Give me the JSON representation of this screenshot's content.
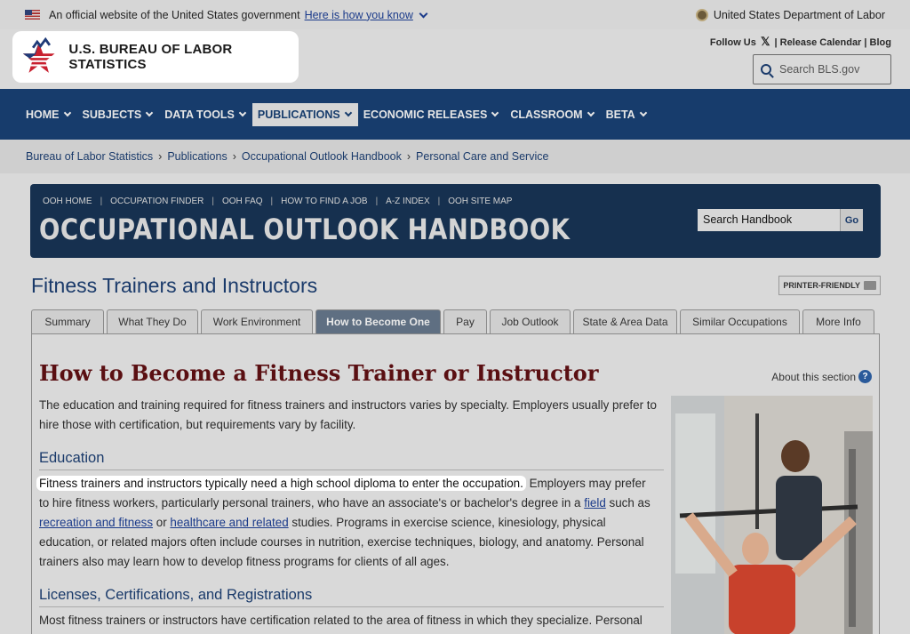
{
  "gov_banner": {
    "official_text": "An official website of the United States government",
    "how_link": "Here is how you know",
    "department": "United States Department of Labor"
  },
  "header": {
    "logo_text": "U.S. BUREAU OF LABOR STATISTICS",
    "follow_us": "Follow Us",
    "release_calendar": "Release Calendar",
    "blog": "Blog",
    "search_placeholder": "Search BLS.gov"
  },
  "nav": {
    "items": [
      {
        "label": "HOME"
      },
      {
        "label": "SUBJECTS"
      },
      {
        "label": "DATA TOOLS"
      },
      {
        "label": "PUBLICATIONS"
      },
      {
        "label": "ECONOMIC RELEASES"
      },
      {
        "label": "CLASSROOM"
      },
      {
        "label": "BETA"
      }
    ]
  },
  "breadcrumb": [
    "Bureau of Labor Statistics",
    "Publications",
    "Occupational Outlook Handbook",
    "Personal Care and Service"
  ],
  "ooh": {
    "links": [
      "OOH HOME",
      "OCCUPATION FINDER",
      "OOH FAQ",
      "HOW TO FIND A JOB",
      "A-Z INDEX",
      "OOH SITE MAP"
    ],
    "title": "OCCUPATIONAL OUTLOOK HANDBOOK",
    "search_value": "Search Handbook",
    "go_label": "Go"
  },
  "page": {
    "title": "Fitness Trainers and Instructors",
    "printer_label": "PRINTER-FRIENDLY"
  },
  "tabs": [
    {
      "label": "Summary"
    },
    {
      "label": "What They Do"
    },
    {
      "label": "Work Environment"
    },
    {
      "label": "How to Become One"
    },
    {
      "label": "Pay"
    },
    {
      "label": "Job Outlook"
    },
    {
      "label": "State & Area Data"
    },
    {
      "label": "Similar Occupations"
    },
    {
      "label": "More Info"
    }
  ],
  "content": {
    "heading": "How to Become a Fitness Trainer or Instructor",
    "about": "About this section",
    "intro": "The education and training required for fitness trainers and instructors varies by specialty. Employers usually prefer to hire those with certification, but requirements vary by facility.",
    "education_heading": "Education",
    "edu_highlight": "Fitness trainers and instructors typically need a high school diploma to enter the occupation.",
    "edu_p1": " Employers may prefer to hire fitness workers, particularly personal trainers, who have an associate's or bachelor's degree in a ",
    "edu_link_field": "field",
    "edu_p2": " such as ",
    "edu_link_rec": "recreation and fitness",
    "edu_p3": " or ",
    "edu_link_health": "healthcare and related",
    "edu_p4": " studies. Programs in exercise science, kinesiology, physical education, or related majors often include courses in nutrition, exercise techniques, biology, and anatomy. Personal trainers also may learn how to develop fitness programs for clients of all ages.",
    "licenses_heading": "Licenses, Certifications, and Registrations",
    "licenses_text": "Most fitness trainers or instructors have certification related to the area of fitness in which they specialize. Personal"
  }
}
